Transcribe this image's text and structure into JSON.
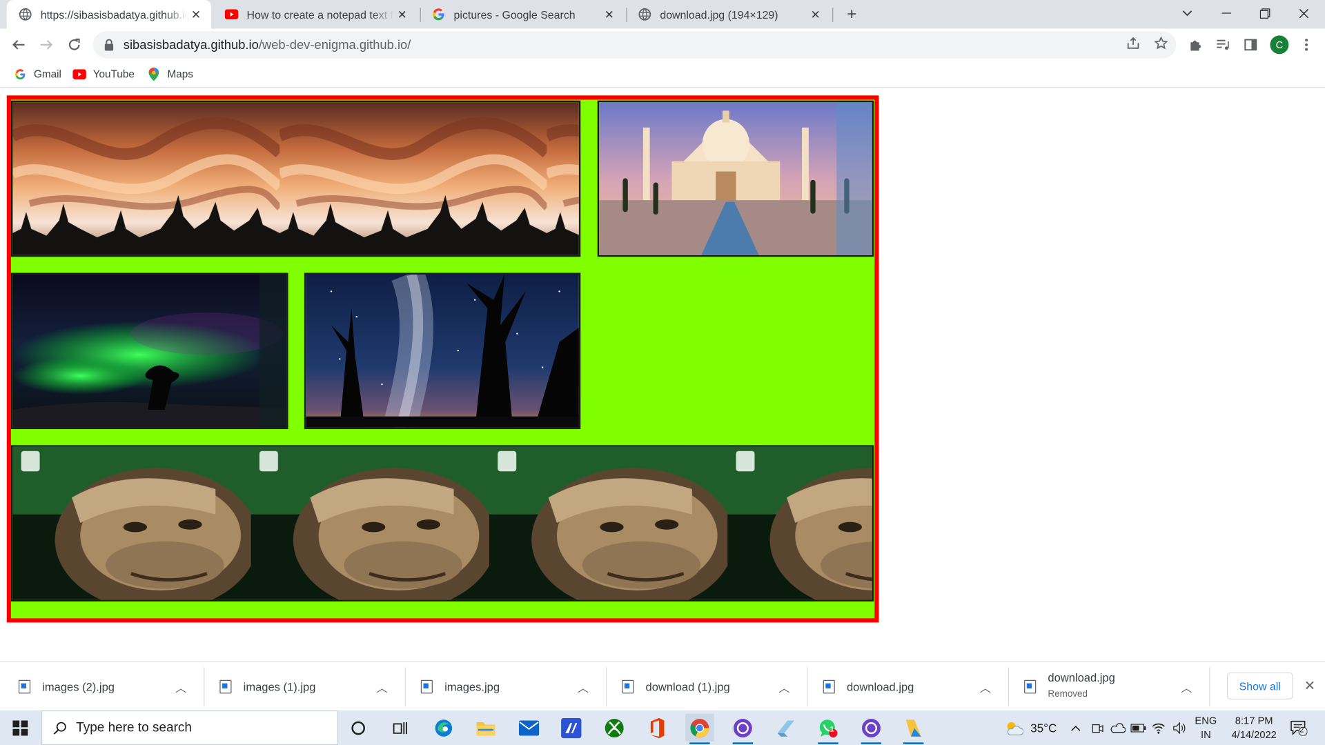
{
  "browser": {
    "tabs": [
      {
        "title": "https://sibasisbadatya.github.io/web-dev-enigma.github.io/",
        "icon": "globe-icon",
        "active": true
      },
      {
        "title": "How to create a notepad text file",
        "icon": "youtube-icon",
        "active": false
      },
      {
        "title": "pictures - Google Search",
        "icon": "google-icon",
        "active": false
      },
      {
        "title": "download.jpg (194×129)",
        "icon": "globe-icon",
        "active": false
      }
    ],
    "new_tab_label": "+",
    "address": {
      "host": "sibasisbadatya.github.io",
      "path": "/web-dev-enigma.github.io/"
    },
    "profile_initial": "C",
    "bookmarks": [
      {
        "label": "Gmail",
        "icon": "google-icon"
      },
      {
        "label": "YouTube",
        "icon": "youtube-icon"
      },
      {
        "label": "Maps",
        "icon": "maps-pin-icon"
      }
    ]
  },
  "page": {
    "border_color": "#ff0000",
    "background_color": "#7fff00",
    "images": [
      "clouds-sunset",
      "taj-mahal",
      "aurora-borealis",
      "milky-way-trees",
      "chimpanzee-face"
    ]
  },
  "downloads": {
    "items": [
      {
        "name": "images (2).jpg",
        "status": ""
      },
      {
        "name": "images (1).jpg",
        "status": ""
      },
      {
        "name": "images.jpg",
        "status": ""
      },
      {
        "name": "download (1).jpg",
        "status": ""
      },
      {
        "name": "download.jpg",
        "status": ""
      },
      {
        "name": "download.jpg",
        "status": "Removed"
      }
    ],
    "show_all": "Show all"
  },
  "taskbar": {
    "search_placeholder": "Type here to search",
    "weather": "35°C",
    "language": "ENG",
    "region": "IN",
    "time": "8:17 PM",
    "date": "4/14/2022",
    "notifications_count": "2",
    "whatsapp_badge": "1"
  }
}
